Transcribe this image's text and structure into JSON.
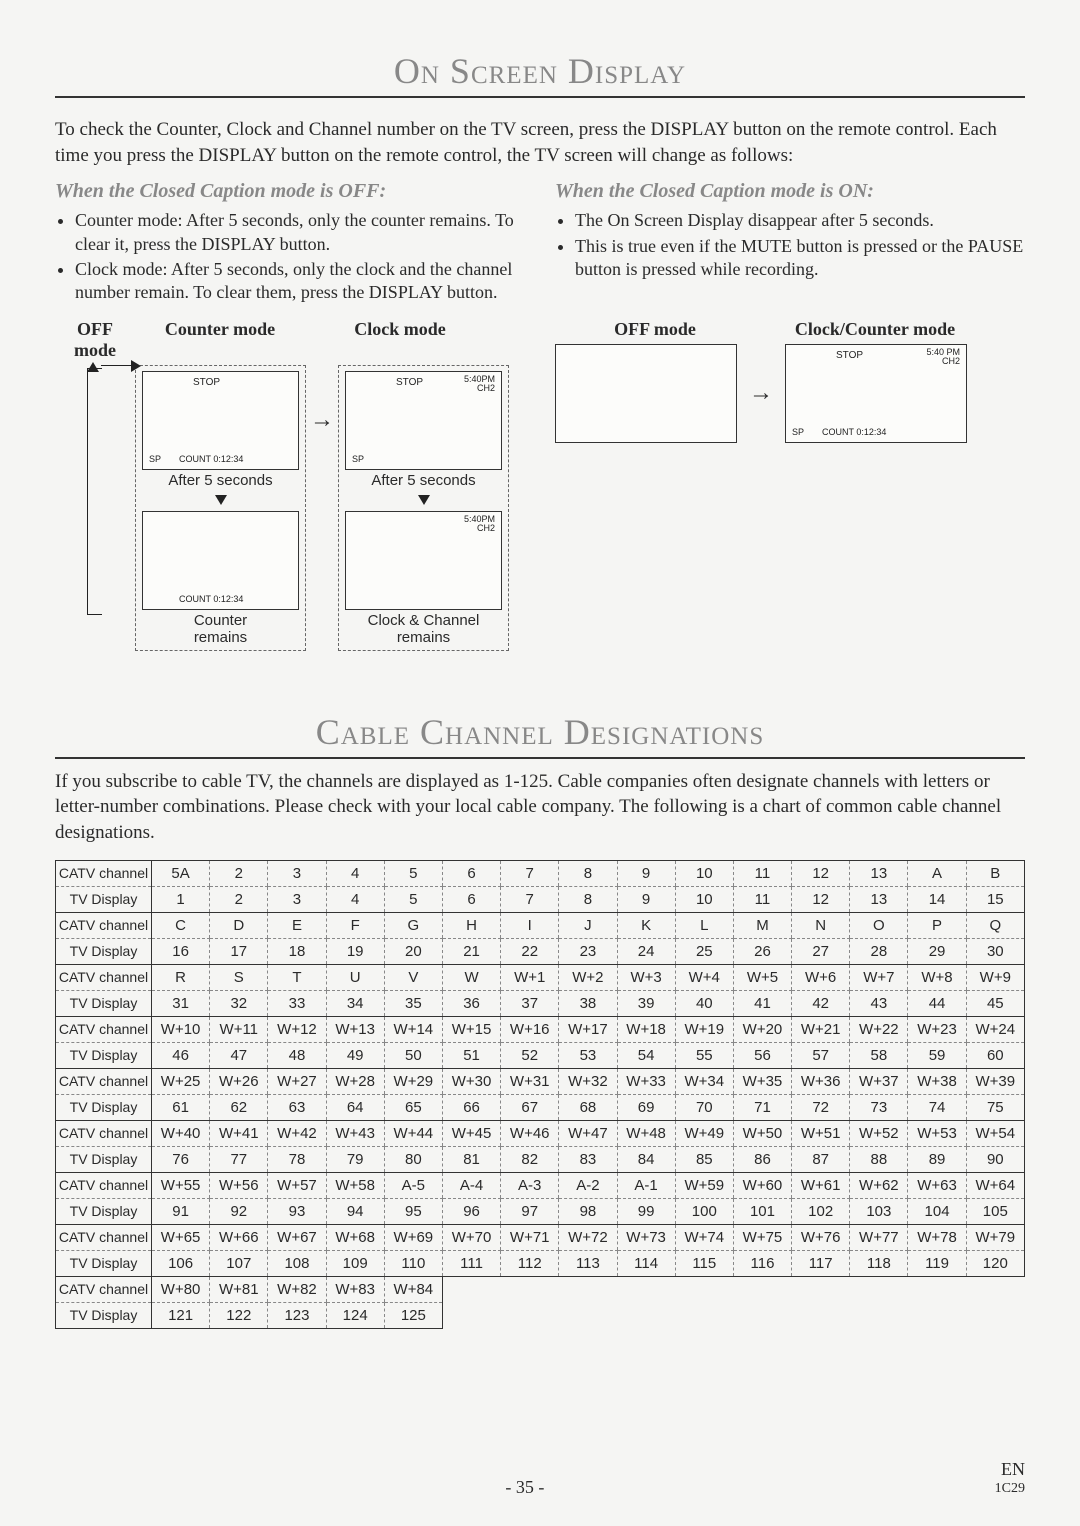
{
  "title1": "On Screen Display",
  "intro1": "To check the Counter, Clock and Channel number on the TV screen, press the DISPLAY button on the remote control. Each time you press the DISPLAY button on the remote control, the TV screen will change as follows:",
  "off_head": "When the Closed Caption mode is OFF:",
  "off_b1": "Counter mode: After 5 seconds, only the counter remains. To clear it, press the DISPLAY button.",
  "off_b2": "Clock mode: After 5 seconds, only the clock and the channel number remain. To clear them, press the DISPLAY button.",
  "on_head": "When the Closed Caption mode is ON:",
  "on_b1": "The On Screen Display disappear after 5 seconds.",
  "on_b2": "This is true even if the MUTE button is pressed or the PAUSE button is pressed while recording.",
  "ml_off": "OFF mode",
  "ml_counter": "Counter mode",
  "ml_clock": "Clock mode",
  "ml_cc": "Clock/Counter mode",
  "scr_stop": "STOP",
  "scr_sp": "SP",
  "scr_count": "COUNT  0:12:34",
  "scr_time1": "5:40PM",
  "scr_time2": "CH2",
  "scr_time1b": "5:40 PM",
  "cap_after5": "After 5 seconds",
  "cap_counter_rem": "Counter",
  "cap_counter_rem2": "remains",
  "cap_clock_rem": "Clock & Channel",
  "cap_clock_rem2": "remains",
  "title2": "Cable Channel Designations",
  "intro2": "If you subscribe to cable TV, the channels are displayed as 1-125. Cable companies often designate channels with letters or letter-number combinations. Please check with your local cable company. The following is a chart of common cable channel designations.",
  "row_hdr_catv": "CATV channel",
  "row_hdr_tv": "TV Display",
  "page_num": "- 35 -",
  "page_lang": "EN",
  "page_code": "1C29",
  "chart_data": {
    "type": "table",
    "pairs": [
      {
        "catv": [
          "5A",
          "2",
          "3",
          "4",
          "5",
          "6",
          "7",
          "8",
          "9",
          "10",
          "11",
          "12",
          "13",
          "A",
          "B"
        ],
        "tv": [
          "1",
          "2",
          "3",
          "4",
          "5",
          "6",
          "7",
          "8",
          "9",
          "10",
          "11",
          "12",
          "13",
          "14",
          "15"
        ]
      },
      {
        "catv": [
          "C",
          "D",
          "E",
          "F",
          "G",
          "H",
          "I",
          "J",
          "K",
          "L",
          "M",
          "N",
          "O",
          "P",
          "Q"
        ],
        "tv": [
          "16",
          "17",
          "18",
          "19",
          "20",
          "21",
          "22",
          "23",
          "24",
          "25",
          "26",
          "27",
          "28",
          "29",
          "30"
        ]
      },
      {
        "catv": [
          "R",
          "S",
          "T",
          "U",
          "V",
          "W",
          "W+1",
          "W+2",
          "W+3",
          "W+4",
          "W+5",
          "W+6",
          "W+7",
          "W+8",
          "W+9"
        ],
        "tv": [
          "31",
          "32",
          "33",
          "34",
          "35",
          "36",
          "37",
          "38",
          "39",
          "40",
          "41",
          "42",
          "43",
          "44",
          "45"
        ]
      },
      {
        "catv": [
          "W+10",
          "W+11",
          "W+12",
          "W+13",
          "W+14",
          "W+15",
          "W+16",
          "W+17",
          "W+18",
          "W+19",
          "W+20",
          "W+21",
          "W+22",
          "W+23",
          "W+24"
        ],
        "tv": [
          "46",
          "47",
          "48",
          "49",
          "50",
          "51",
          "52",
          "53",
          "54",
          "55",
          "56",
          "57",
          "58",
          "59",
          "60"
        ]
      },
      {
        "catv": [
          "W+25",
          "W+26",
          "W+27",
          "W+28",
          "W+29",
          "W+30",
          "W+31",
          "W+32",
          "W+33",
          "W+34",
          "W+35",
          "W+36",
          "W+37",
          "W+38",
          "W+39"
        ],
        "tv": [
          "61",
          "62",
          "63",
          "64",
          "65",
          "66",
          "67",
          "68",
          "69",
          "70",
          "71",
          "72",
          "73",
          "74",
          "75"
        ]
      },
      {
        "catv": [
          "W+40",
          "W+41",
          "W+42",
          "W+43",
          "W+44",
          "W+45",
          "W+46",
          "W+47",
          "W+48",
          "W+49",
          "W+50",
          "W+51",
          "W+52",
          "W+53",
          "W+54"
        ],
        "tv": [
          "76",
          "77",
          "78",
          "79",
          "80",
          "81",
          "82",
          "83",
          "84",
          "85",
          "86",
          "87",
          "88",
          "89",
          "90"
        ]
      },
      {
        "catv": [
          "W+55",
          "W+56",
          "W+57",
          "W+58",
          "A-5",
          "A-4",
          "A-3",
          "A-2",
          "A-1",
          "W+59",
          "W+60",
          "W+61",
          "W+62",
          "W+63",
          "W+64"
        ],
        "tv": [
          "91",
          "92",
          "93",
          "94",
          "95",
          "96",
          "97",
          "98",
          "99",
          "100",
          "101",
          "102",
          "103",
          "104",
          "105"
        ]
      },
      {
        "catv": [
          "W+65",
          "W+66",
          "W+67",
          "W+68",
          "W+69",
          "W+70",
          "W+71",
          "W+72",
          "W+73",
          "W+74",
          "W+75",
          "W+76",
          "W+77",
          "W+78",
          "W+79"
        ],
        "tv": [
          "106",
          "107",
          "108",
          "109",
          "110",
          "111",
          "112",
          "113",
          "114",
          "115",
          "116",
          "117",
          "118",
          "119",
          "120"
        ]
      },
      {
        "catv": [
          "W+80",
          "W+81",
          "W+82",
          "W+83",
          "W+84"
        ],
        "tv": [
          "121",
          "122",
          "123",
          "124",
          "125"
        ]
      }
    ]
  }
}
